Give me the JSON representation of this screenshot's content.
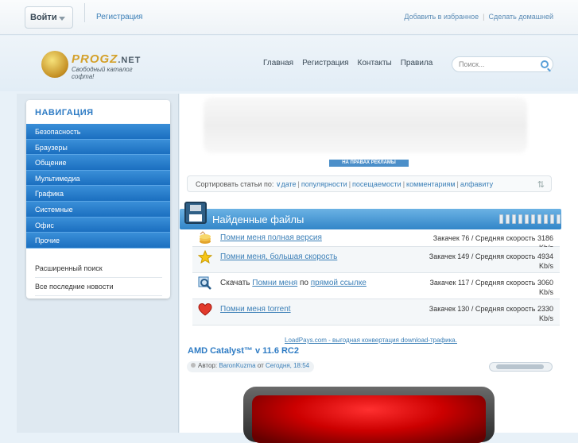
{
  "topbar": {
    "login_label": "Войти",
    "register_label": "Регистрация",
    "add_favorites": "Добавить в избранное",
    "make_home": "Сделать домашней"
  },
  "header": {
    "logo_name": "PROGZ",
    "logo_tld": ".NET",
    "logo_tagline": "Свободный каталог софта!",
    "nav": [
      "Главная",
      "Регистрация",
      "Контакты",
      "Правила"
    ],
    "search_placeholder": "Поиск..."
  },
  "sidebar": {
    "title": "НАВИГАЦИЯ",
    "items": [
      "Безопасность",
      "Браузеры",
      "Общение",
      "Мультимедиа",
      "Графика",
      "Системные",
      "Офис",
      "Прочие"
    ],
    "extra": [
      "Расширенный поиск",
      "Все последние новости"
    ]
  },
  "ad": {
    "label": "НА ПРАВАХ РЕКЛАМЫ"
  },
  "sort": {
    "prefix": "Сортировать статьи по:",
    "options": [
      "дате",
      "популярности",
      "посещаемости",
      "комментариям",
      "алфавиту"
    ]
  },
  "files": {
    "title": "Найденные файлы",
    "rows": [
      {
        "icon": "coins-icon",
        "link": "Помни меня полная версия",
        "stat": "Закачек 76 / Средняя скорость 3186 Kb/s"
      },
      {
        "icon": "star-icon",
        "link": "Помни меня, большая скорость",
        "stat": "Закачек 149 / Средняя скорость 4934 Kb/s"
      },
      {
        "icon": "magnifier-icon",
        "pre": "Скачать",
        "link": "Помни меня",
        "mid": "по",
        "link2": "прямой ссылке",
        "stat": "Закачек 117 / Средняя скорость 3060 Kb/s"
      },
      {
        "icon": "heart-icon",
        "link": "Помни меня torrent",
        "stat": "Закачек 130 / Средняя скорость 2330 Kb/s"
      }
    ]
  },
  "loadpays": "LoadPays.com - выгодная конвертация download-трафика.",
  "article": {
    "title": "AMD Catalyst™ v 11.6 RC2",
    "author_prefix": "Автор:",
    "author": "BaronKuzma",
    "date_prefix": "от",
    "date": "Сегодня, 18:54"
  },
  "colors": {
    "accent": "#2d7bc4",
    "nav_blue": "#1b6fc0",
    "link": "#3b7fb7"
  }
}
